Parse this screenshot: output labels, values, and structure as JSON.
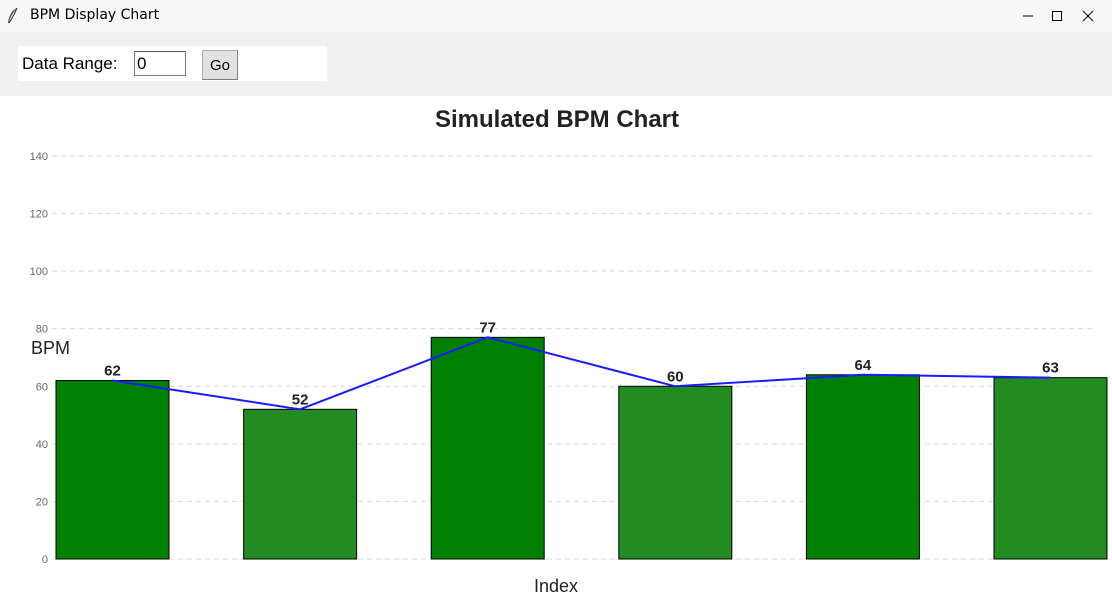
{
  "window": {
    "title": "BPM Display Chart",
    "controls": {
      "minimize_icon": "minimize-icon",
      "maximize_icon": "maximize-icon",
      "close_icon": "close-icon"
    }
  },
  "controls": {
    "range_label": "Data Range:",
    "range_value": "0",
    "go_label": "Go"
  },
  "colors": {
    "bar_dark": "#008000",
    "bar_light": "#228b22",
    "line": "#1a1aff",
    "grid": "#d9d9d9"
  },
  "chart_data": {
    "type": "bar",
    "title": "Simulated BPM Chart",
    "xlabel": "Index",
    "ylabel": "BPM",
    "ylim": [
      0,
      140
    ],
    "yticks": [
      0,
      20,
      40,
      60,
      80,
      100,
      120,
      140
    ],
    "grid": true,
    "values": [
      62,
      52,
      77,
      60,
      64,
      63
    ],
    "data_labels": [
      "62",
      "52",
      "77",
      "60",
      "64",
      "63"
    ],
    "overlay_line": true
  }
}
